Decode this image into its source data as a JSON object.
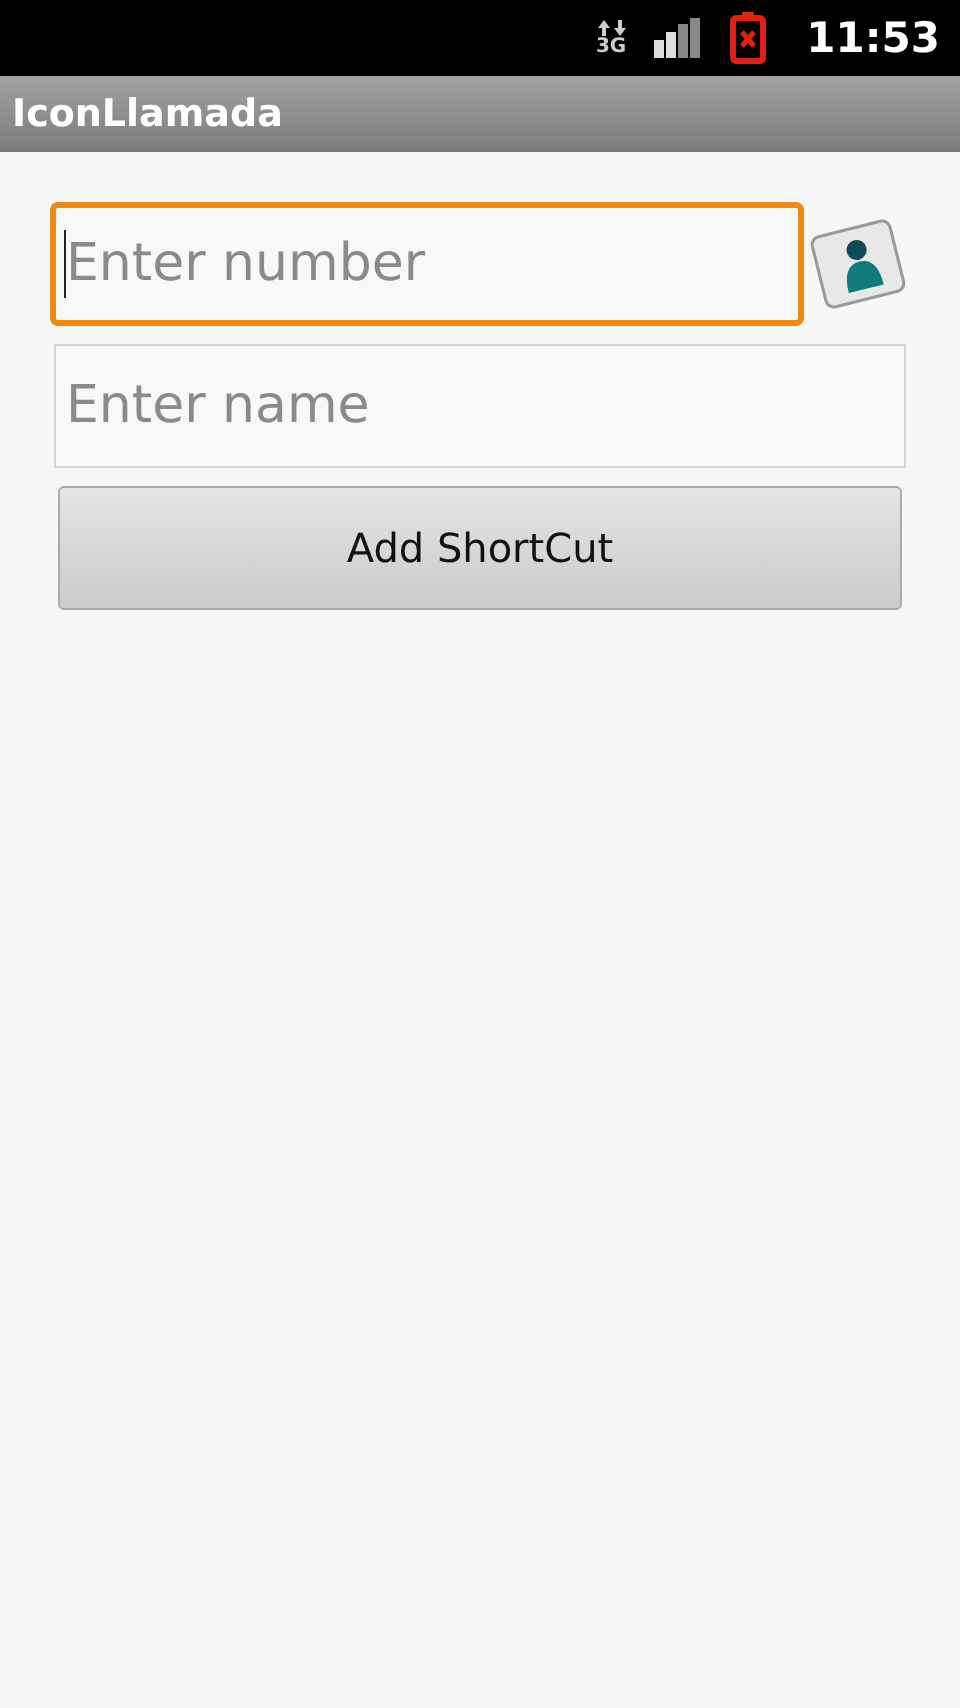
{
  "status_bar": {
    "network": "3G",
    "time": "11:53"
  },
  "app_bar": {
    "title": "IconLlamada"
  },
  "fields": [
    {
      "placeholder": "Enter number",
      "focused": true,
      "kind": "phone"
    },
    {
      "placeholder": "Enter name",
      "focused": false,
      "kind": "text"
    }
  ],
  "button": {
    "label": "Add ShortCut"
  }
}
